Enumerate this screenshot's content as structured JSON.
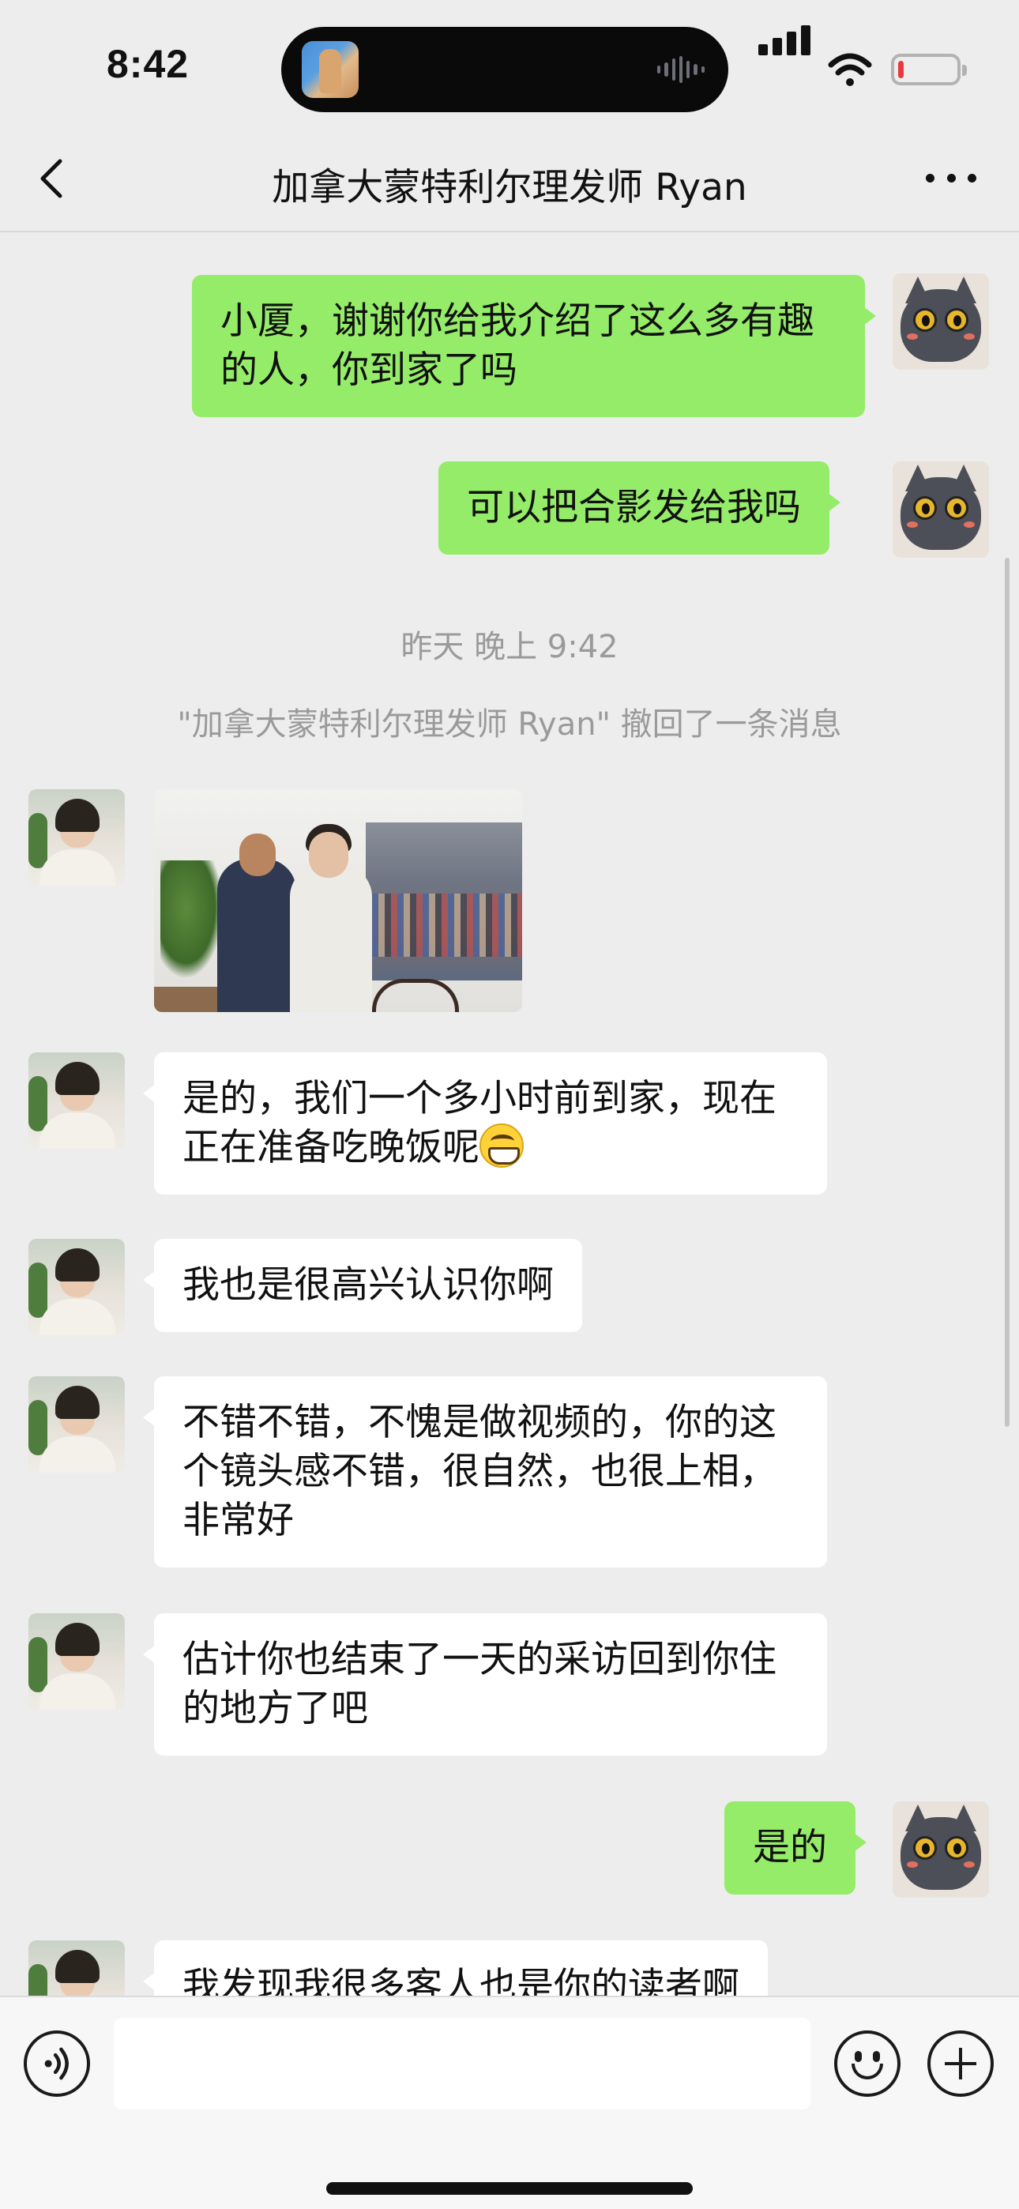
{
  "status_bar": {
    "time": "8:42",
    "battery_level_pct": 10,
    "battery_color": "#e9393d"
  },
  "nav": {
    "back_icon": "chevron-left-icon",
    "title": "加拿大蒙特利尔理发师 Ryan",
    "more_icon": "more-dots-icon"
  },
  "colors": {
    "outgoing_bubble": "#95ec69",
    "incoming_bubble": "#ffffff",
    "chat_background": "#ededed"
  },
  "messages": [
    {
      "side": "out",
      "text": "小厦，谢谢你给我介绍了这么多有趣的人，你到家了吗"
    },
    {
      "side": "out",
      "text": "可以把合影发给我吗"
    },
    {
      "side": "system",
      "text": "昨天 晚上 9:42"
    },
    {
      "side": "system",
      "text": "\"加拿大蒙特利尔理发师 Ryan\" 撤回了一条消息"
    },
    {
      "side": "in",
      "type": "image",
      "text": ""
    },
    {
      "side": "in",
      "text": "是的，我们一个多小时前到家，现在正在准备吃晚饭呢",
      "emoji": "grinning-face-emoji"
    },
    {
      "side": "in",
      "text": "我也是很高兴认识你啊"
    },
    {
      "side": "in",
      "text": "不错不错，不愧是做视频的，你的这个镜头感不错，很自然，也很上相，非常好"
    },
    {
      "side": "in",
      "text": "估计你也结束了一天的采访回到你住的地方了吧"
    },
    {
      "side": "out",
      "text": "是的"
    },
    {
      "side": "in",
      "text": "我发现我很多客人也是你的读者啊"
    }
  ],
  "input_bar": {
    "voice_icon": "voice-icon",
    "input_value": "",
    "emoji_icon": "emoji-icon",
    "plus_icon": "plus-icon"
  }
}
